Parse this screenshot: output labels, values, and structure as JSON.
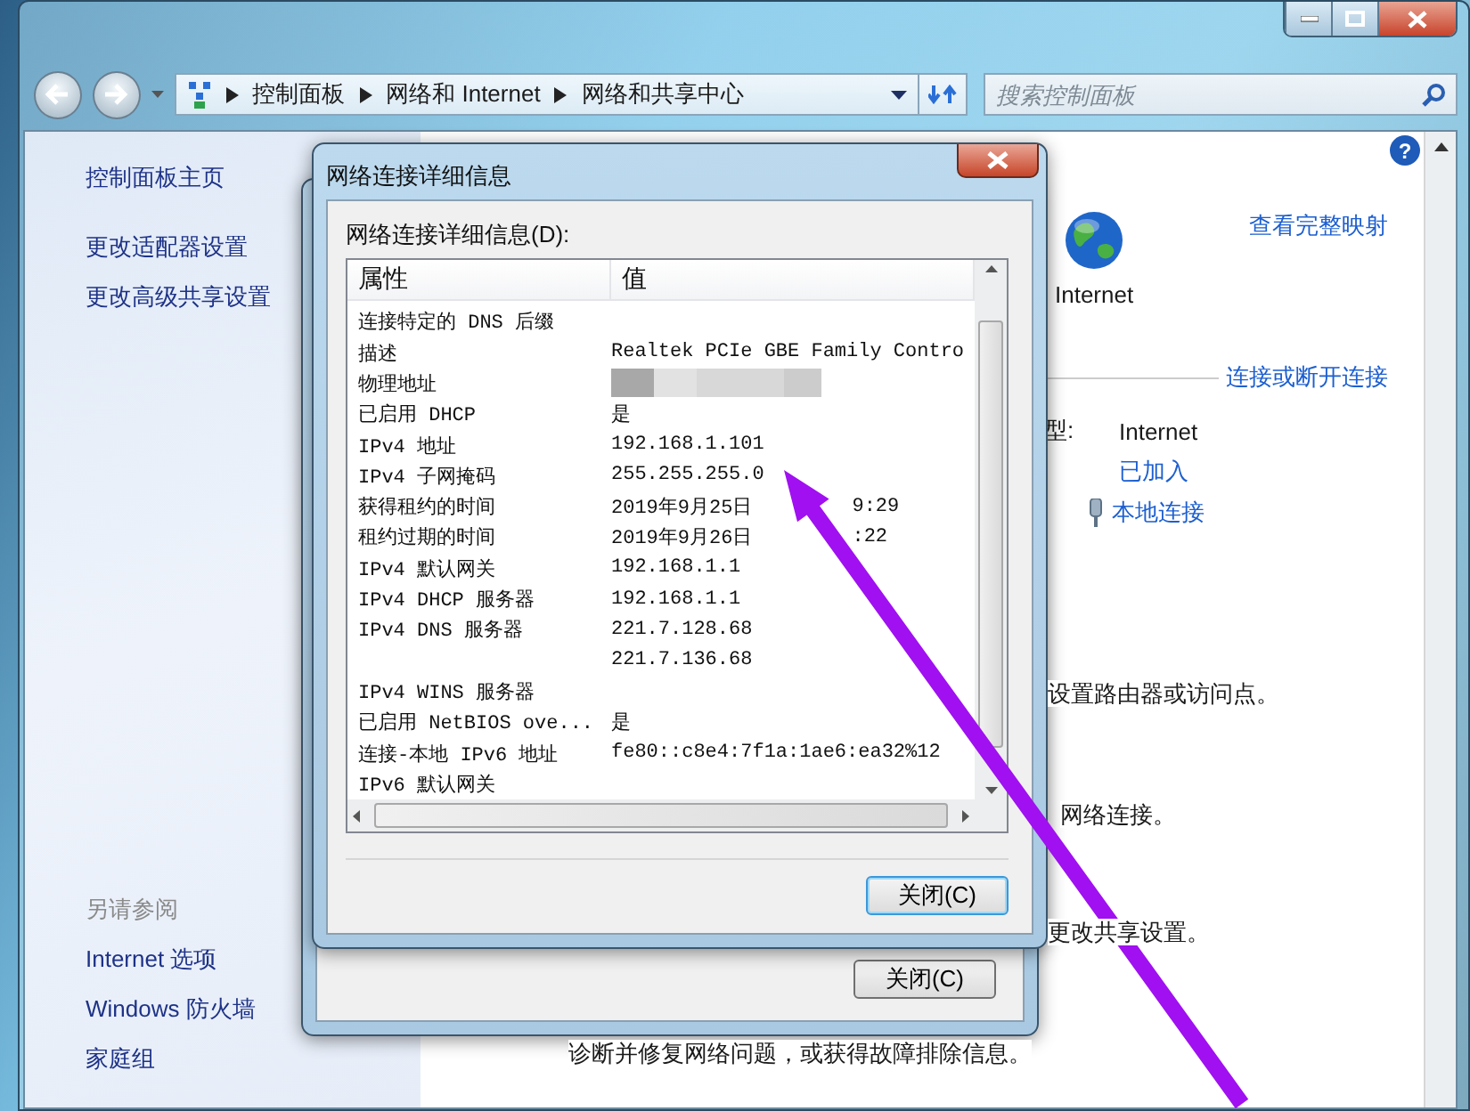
{
  "navigation": {
    "breadcrumb": [
      "控制面板",
      "网络和 Internet",
      "网络和共享中心"
    ],
    "search": {
      "placeholder": "搜索控制面板"
    }
  },
  "help_button": "?",
  "sidebar": {
    "links": [
      "控制面板主页",
      "更改适配器设置",
      "更改高级共享设置"
    ],
    "see_also": {
      "heading": "另请参阅",
      "links": [
        "Internet 选项",
        "Windows 防火墙",
        "家庭组"
      ]
    }
  },
  "main": {
    "view_full_map": "查看完整映射",
    "network_label": "Internet",
    "connect_link": "连接或断开连接",
    "type_label": "型:",
    "type_value": "Internet",
    "homegroup_value": "已加入",
    "connection_link": "本地连接",
    "text_1": "设置路由器或访问点。",
    "text_2": "网络连接。",
    "text_3": "更改共享设置。",
    "troubleshoot_text": "诊断并修复网络问题，或获得故障排除信息。"
  },
  "status_dialog": {
    "close_button": "关闭(C)"
  },
  "details_dialog": {
    "title": "网络连接详细信息",
    "list_label": "网络连接详细信息(D):",
    "columns": [
      "属性",
      "值"
    ],
    "rows": [
      {
        "kind": "text",
        "property": "连接特定的 DNS 后缀"
      },
      {
        "kind": "text",
        "property": "描述",
        "value": "Realtek PCIe GBE Family Contro"
      },
      {
        "kind": "masked",
        "property": "物理地址"
      },
      {
        "kind": "text",
        "property": "已启用 DHCP",
        "value": "是"
      },
      {
        "kind": "text",
        "property": "IPv4 地址",
        "value": "192.168.1.101"
      },
      {
        "kind": "text",
        "property": "IPv4 子网掩码",
        "value": "255.255.255.0"
      },
      {
        "kind": "text",
        "property": "获得租约的时间",
        "value": "2019年9月25日",
        "value_rest": "9:29"
      },
      {
        "kind": "text",
        "property": "租约过期的时间",
        "value": "2019年9月26日",
        "value_rest": ":22"
      },
      {
        "kind": "text",
        "property": "IPv4 默认网关",
        "value": "192.168.1.1"
      },
      {
        "kind": "text",
        "property": "IPv4 DHCP 服务器",
        "value": "192.168.1.1"
      },
      {
        "kind": "text",
        "property": "IPv4 DNS 服务器",
        "value": "221.7.128.68"
      },
      {
        "kind": "text",
        "value": "221.7.136.68"
      },
      {
        "kind": "text",
        "property": "IPv4 WINS 服务器"
      },
      {
        "kind": "text",
        "property": "已启用 NetBIOS ove...",
        "value": "是"
      },
      {
        "kind": "text",
        "property": "连接-本地 IPv6 地址",
        "value": "fe80::c8e4:7f1a:1ae6:ea32%12"
      },
      {
        "kind": "text",
        "property": "IPv6 默认网关"
      }
    ],
    "close_button": "关闭(C)"
  }
}
